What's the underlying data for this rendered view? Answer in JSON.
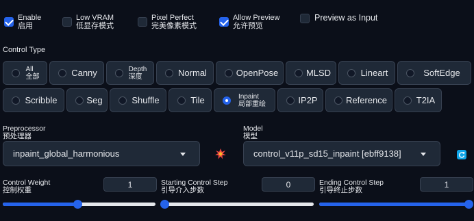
{
  "top_options": [
    {
      "label_en": "Enable",
      "label_zh": "启用",
      "checked": true
    },
    {
      "label_en": "Low VRAM",
      "label_zh": "低显存模式",
      "checked": false
    },
    {
      "label_en": "Pixel Perfect",
      "label_zh": "完美像素模式",
      "checked": false
    },
    {
      "label_en": "Allow Preview",
      "label_zh": "允许预览",
      "checked": true
    },
    {
      "label_en": "Preview as Input",
      "label_zh": "",
      "checked": false
    }
  ],
  "control_type": {
    "label": "Control Type",
    "row1": [
      {
        "en": "All",
        "zh": "全部"
      },
      {
        "en": "Canny"
      },
      {
        "en": "Depth",
        "zh": "深度"
      },
      {
        "en": "Normal"
      },
      {
        "en": "OpenPose"
      },
      {
        "en": "MLSD"
      },
      {
        "en": "Lineart"
      },
      {
        "en": "SoftEdge"
      }
    ],
    "row2": [
      {
        "en": "Scribble"
      },
      {
        "en": "Seg"
      },
      {
        "en": "Shuffle"
      },
      {
        "en": "Tile"
      },
      {
        "en": "Inpaint",
        "zh": "局部重绘"
      },
      {
        "en": "IP2P"
      },
      {
        "en": "Reference"
      },
      {
        "en": "T2IA"
      }
    ],
    "selected": "Inpaint"
  },
  "preprocessor": {
    "label_en": "Preprocessor",
    "label_zh": "预处理器",
    "value": "inpaint_global_harmonious"
  },
  "model": {
    "label_en": "Model",
    "label_zh": "模型",
    "value": "control_v11p_sd15_inpaint [ebff9138]"
  },
  "sliders": [
    {
      "label_en": "Control Weight",
      "label_zh": "控制权重",
      "value": "1",
      "fraction": 0.49
    },
    {
      "label_en": "Starting Control Step",
      "label_zh": "引导介入步数",
      "value": "0",
      "fraction": 0.0
    },
    {
      "label_en": "Ending Control Step",
      "label_zh": "引导终止步数",
      "value": "1",
      "fraction": 1.0
    }
  ],
  "icons": {
    "run": "explosion-icon",
    "refresh": "refresh-icon"
  },
  "colors": {
    "accent": "#2563eb",
    "background": "#0b0f19",
    "panel": "#1f2937"
  }
}
